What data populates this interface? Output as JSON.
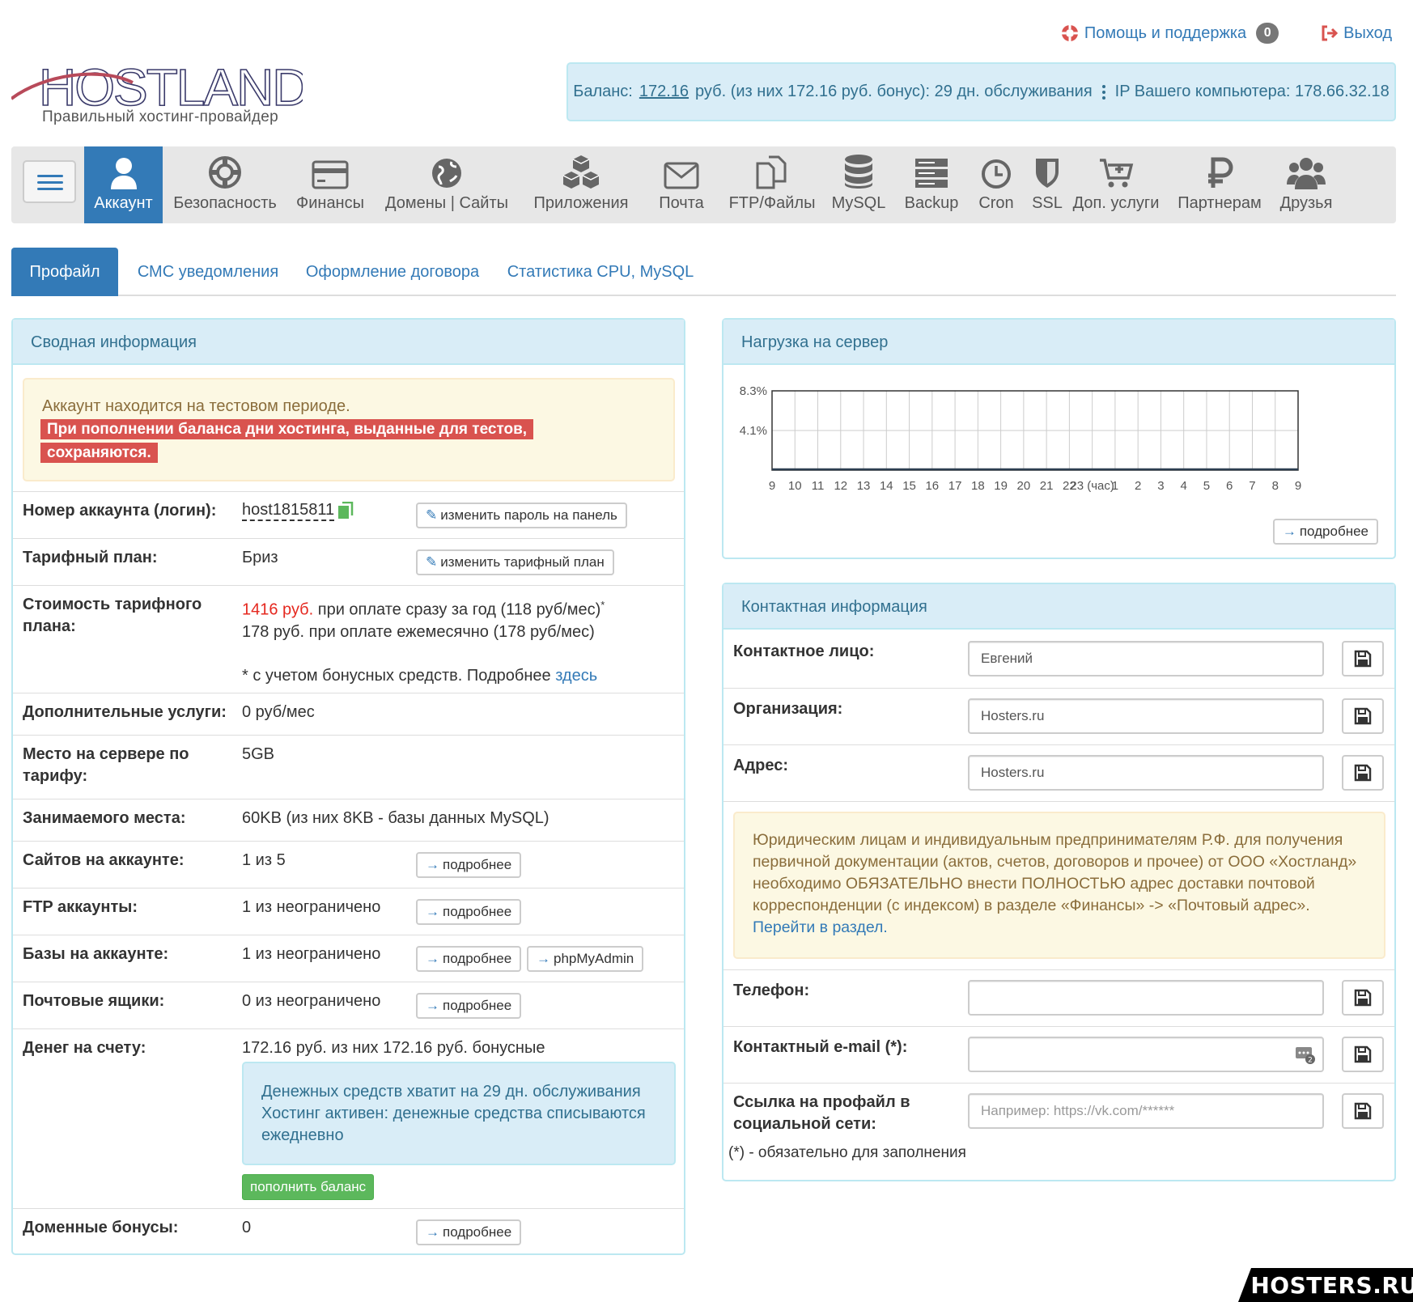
{
  "header": {
    "help_label": "Помощь и поддержка",
    "help_count": "0",
    "logout_label": "Выход",
    "logo_text": "HOSTLAND",
    "logo_tagline": "Правильный хостинг-провайдер",
    "balance_prefix": "Баланс:",
    "balance_amount": "172.16",
    "balance_rest": "руб. (из них 172.16 руб. бонус): 29 дн. обслуживания",
    "ip_label": "IP Вашего компьютера: 178.66.32.18"
  },
  "nav": [
    {
      "label": "Аккаунт",
      "icon": "user-icon"
    },
    {
      "label": "Безопасность",
      "icon": "lifebuoy-icon"
    },
    {
      "label": "Финансы",
      "icon": "credit-card-icon"
    },
    {
      "label": "Домены | Сайты",
      "icon": "globe-icon"
    },
    {
      "label": "Приложения",
      "icon": "cubes-icon"
    },
    {
      "label": "Почта",
      "icon": "envelope-icon"
    },
    {
      "label": "FTP/Файлы",
      "icon": "files-icon"
    },
    {
      "label": "MySQL",
      "icon": "database-icon"
    },
    {
      "label": "Backup",
      "icon": "server-icon"
    },
    {
      "label": "Cron",
      "icon": "clock-icon"
    },
    {
      "label": "SSL",
      "icon": "shield-icon"
    },
    {
      "label": "Доп. услуги",
      "icon": "cart-plus-icon"
    },
    {
      "label": "Партнерам",
      "icon": "ruble-icon"
    },
    {
      "label": "Друзья",
      "icon": "users-icon"
    }
  ],
  "tabs": [
    "Профайл",
    "СМС уведомления",
    "Оформление договора",
    "Статистика CPU, MySQL"
  ],
  "summary": {
    "title": "Сводная информация",
    "trial_text": "Аккаунт находится на тестовом периоде.",
    "trial_warning": "При пополнении баланса дни хостинга, выданные для тестов, сохраняются.",
    "rows": {
      "account_label": "Номер аккаунта (логин):",
      "account_value": "host1815811",
      "account_btn": "изменить пароль на панель",
      "plan_label": "Тарифный план:",
      "plan_value": "Бриз",
      "plan_btn": "изменить тарифный план",
      "cost_label": "Стоимость тарифного плана:",
      "cost_year_price": "1416 руб.",
      "cost_year_rest": "при оплате сразу за год (118 руб/мес)",
      "cost_year_star": "*",
      "cost_month": "178 руб. при оплате ежемесячно (178 руб/мес)",
      "cost_note": "* с учетом бонусных средств. Подробнее",
      "cost_note_link": "здесь",
      "extra_label": "Дополнительные услуги:",
      "extra_value": "0 руб/мес",
      "space_label": "Место на сервере по тарифу:",
      "space_value": "5GB",
      "used_label": "Занимаемого места:",
      "used_value": "60KB (из них 8KB - базы данных MySQL)",
      "sites_label": "Сайтов на аккаунте:",
      "sites_value": "1 из 5",
      "ftp_label": "FTP аккаунты:",
      "ftp_value": "1 из неограничено",
      "db_label": "Базы на аккаунте:",
      "db_value": "1 из неограничено",
      "phpmyadmin_btn": "phpMyAdmin",
      "mail_label": "Почтовые ящики:",
      "mail_value": "0 из неограничено",
      "money_label": "Денег на счету:",
      "money_value": "172.16 руб. из них 172.16 руб. бонусные",
      "money_info": "Денежных средств хватит на 29 дн. обслуживания Хостинг активен: денежные средства списываются ежедневно",
      "topup_btn": "пополнить баланс",
      "domain_bonus_label": "Доменные бонусы:",
      "domain_bonus_value": "0"
    },
    "more_btn": "подробнее"
  },
  "load": {
    "title": "Нагрузка на сервер",
    "more_btn": "подробнее"
  },
  "chart_data": {
    "type": "line",
    "title": "",
    "x": [
      "9",
      "10",
      "11",
      "12",
      "13",
      "14",
      "15",
      "16",
      "17",
      "18",
      "19",
      "20",
      "21",
      "22",
      "23 (час)",
      "1",
      "2",
      "3",
      "4",
      "5",
      "6",
      "7",
      "8",
      "9"
    ],
    "series": [
      {
        "values": [
          0,
          0,
          0,
          0,
          0,
          0,
          0,
          0,
          0,
          0,
          0,
          0,
          0,
          0,
          0,
          0,
          0,
          0,
          0,
          0,
          0,
          0,
          0,
          0
        ]
      }
    ],
    "yticks": [
      "8.3%",
      "4.1%"
    ],
    "ylim": [
      0,
      8.3
    ],
    "grid": true,
    "colors": {
      "line": "#2c3e50",
      "grid": "#cccccc"
    }
  },
  "contact": {
    "title": "Контактная информация",
    "person_label": "Контактное лицо:",
    "person_value": "Евгений",
    "org_label": "Организация:",
    "org_value": "Hosters.ru",
    "addr_label": "Адрес:",
    "addr_value": "Hosters.ru",
    "notice": "Юридическим лицам и индивидуальным предпринимателям Р.Ф. для получения первичной документации (актов, счетов, договоров и прочее) от ООО «Хостланд» необходимо ОБЯЗАТЕЛЬНО внести ПОЛНОСТЬЮ адрес доставки почтовой корреспонденции (с индексом) в разделе «Финансы» -> «Почтовый адрес».",
    "notice_link": "Перейти в раздел.",
    "phone_label": "Телефон:",
    "phone_value": "",
    "email_label": "Контактный e-mail (*):",
    "email_value": "",
    "social_label": "Ссылка на профайл в социальной сети:",
    "social_placeholder": "Например: https://vk.com/******",
    "required_note": "(*) - обязательно для заполнения"
  },
  "watermark": "HOSTERS.RU",
  "colors": {
    "primary": "#337ab7",
    "info_bg": "#d9edf7",
    "warn_bg": "#fcf8e3",
    "danger": "#d9534f",
    "success": "#5cb85c"
  }
}
